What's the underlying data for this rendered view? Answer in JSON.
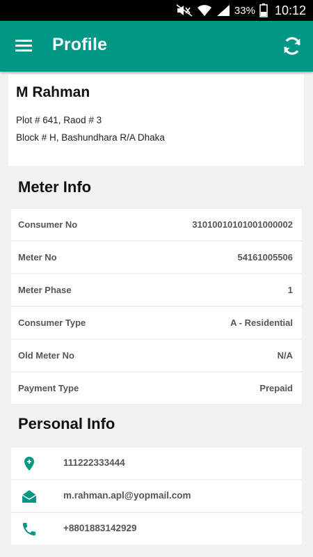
{
  "status_bar": {
    "battery": "33%",
    "time": "10:12"
  },
  "app_bar": {
    "title": "Profile"
  },
  "address": {
    "name": "M Rahman",
    "line1": "Plot # 641, Raod # 3",
    "line2": "Block # H, Bashundhara R/A Dhaka"
  },
  "meter_info": {
    "title": "Meter Info",
    "rows": [
      {
        "label": "Consumer No",
        "value": "31010010101001000002"
      },
      {
        "label": "Meter No",
        "value": "54161005506"
      },
      {
        "label": "Meter Phase",
        "value": "1"
      },
      {
        "label": "Consumer Type",
        "value": "A - Residential"
      },
      {
        "label": "Old Meter No",
        "value": "N/A"
      },
      {
        "label": "Payment Type",
        "value": "Prepaid"
      }
    ]
  },
  "personal_info": {
    "title": "Personal Info",
    "rows": [
      {
        "icon": "location-pin-icon",
        "value": "111222333444"
      },
      {
        "icon": "mail-open-icon",
        "value": "m.rahman.apl@yopmail.com"
      },
      {
        "icon": "phone-icon",
        "value": "+8801883142929"
      }
    ]
  },
  "colors": {
    "primary": "#009786",
    "background": "#f1f1f1"
  }
}
